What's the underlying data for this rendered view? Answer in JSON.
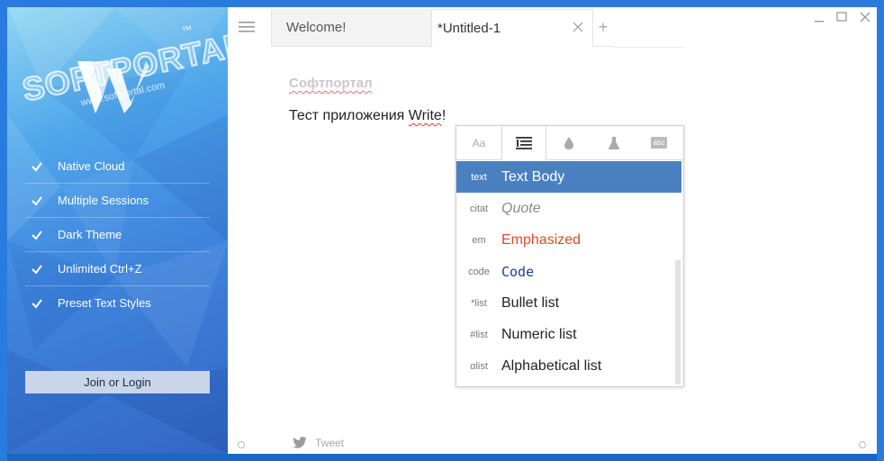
{
  "watermark": {
    "text": "SOFTPORTAL",
    "sub": "www.softportal.com",
    "mark": "™"
  },
  "sidebar": {
    "features": [
      {
        "label": "Native Cloud"
      },
      {
        "label": "Multiple Sessions"
      },
      {
        "label": "Dark Theme"
      },
      {
        "label": "Unlimited Ctrl+Z"
      },
      {
        "label": "Preset Text Styles"
      }
    ],
    "join_label": "Join or Login"
  },
  "tabs": [
    {
      "label": "Welcome!"
    },
    {
      "label": "*Untitled-1"
    }
  ],
  "tab_add": "+",
  "document": {
    "title": "Софтпортал",
    "body_text": "Тест приложения ",
    "body_word": "Write",
    "body_end": "!"
  },
  "style_popup": {
    "tabs": [
      {
        "icon": "font-case-icon",
        "text": "Aa"
      },
      {
        "icon": "paragraph-style-icon"
      },
      {
        "icon": "color-drop-icon"
      },
      {
        "icon": "flask-icon"
      },
      {
        "icon": "spellcheck-icon",
        "text": "abc"
      }
    ],
    "styles": [
      {
        "tag": "text",
        "name": "Text Body",
        "selected": true
      },
      {
        "tag": "citat",
        "name": "Quote"
      },
      {
        "tag": "em",
        "name": "Emphasized"
      },
      {
        "tag": "code",
        "name": "Code"
      },
      {
        "tag": "*list",
        "name": "Bullet list"
      },
      {
        "tag": "#list",
        "name": "Numeric list"
      },
      {
        "tag": "αlist",
        "name": "Alphabetical list"
      }
    ]
  },
  "footer": {
    "tweet_label": "Tweet"
  },
  "colors": {
    "accent": "#4a80bf",
    "emphasis": "#e04a2a",
    "code": "#1e3f8a"
  }
}
